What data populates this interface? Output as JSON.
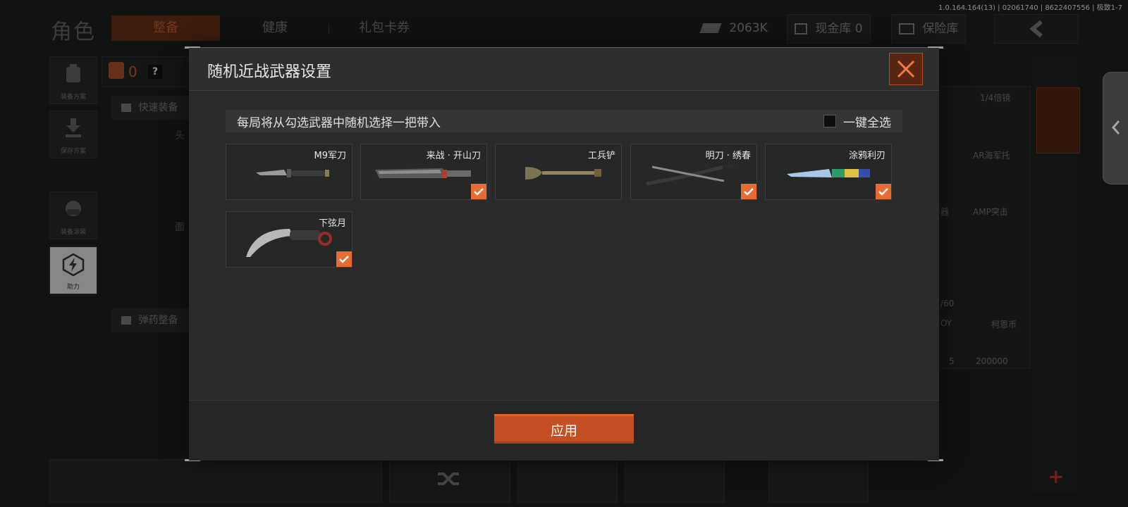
{
  "version_info": "1.0.164.164(13) | 02061740 | 8622407556 | 极致1-7",
  "background": {
    "title": "角色",
    "tabs": [
      "整备",
      "健康",
      "礼包卡券"
    ],
    "currency": {
      "money": "2063K",
      "vault": "现金库 0",
      "insurance": "保险库"
    },
    "side_buttons": [
      "装备方案",
      "保存方案",
      "装备涂装",
      "助力"
    ],
    "bag_count": "0",
    "help_icon": "?",
    "quick_equip": "快速装备",
    "ammo_equip": "弹药整备",
    "slot_labels": [
      "头",
      "面"
    ],
    "store_labels": [
      "1/4倍镜",
      "AR海军托",
      "AMP突击",
      "器",
      "/60",
      "OY",
      "5",
      "柯恩币",
      "200000"
    ]
  },
  "modal": {
    "title": "随机近战武器设置",
    "description": "每局将从勾选武器中随机选择一把带入",
    "select_all_label": "一键全选",
    "select_all_checked": false,
    "weapons": [
      {
        "name": "M9军刀",
        "icon": "combat-knife-icon",
        "checked": false
      },
      {
        "name": "来战 · 开山刀",
        "icon": "machete-icon",
        "checked": true
      },
      {
        "name": "工兵铲",
        "icon": "shovel-icon",
        "checked": false
      },
      {
        "name": "明刀 · 绣春",
        "icon": "dao-sword-icon",
        "checked": true
      },
      {
        "name": "涂鸦利刃",
        "icon": "graffiti-blade-icon",
        "checked": true
      },
      {
        "name": "下弦月",
        "icon": "karambit-icon",
        "checked": true
      }
    ],
    "apply_label": "应用"
  },
  "colors": {
    "accent": "#e96a33",
    "apply_button": "#c44f25",
    "close_button_bg": "#5a2614"
  }
}
